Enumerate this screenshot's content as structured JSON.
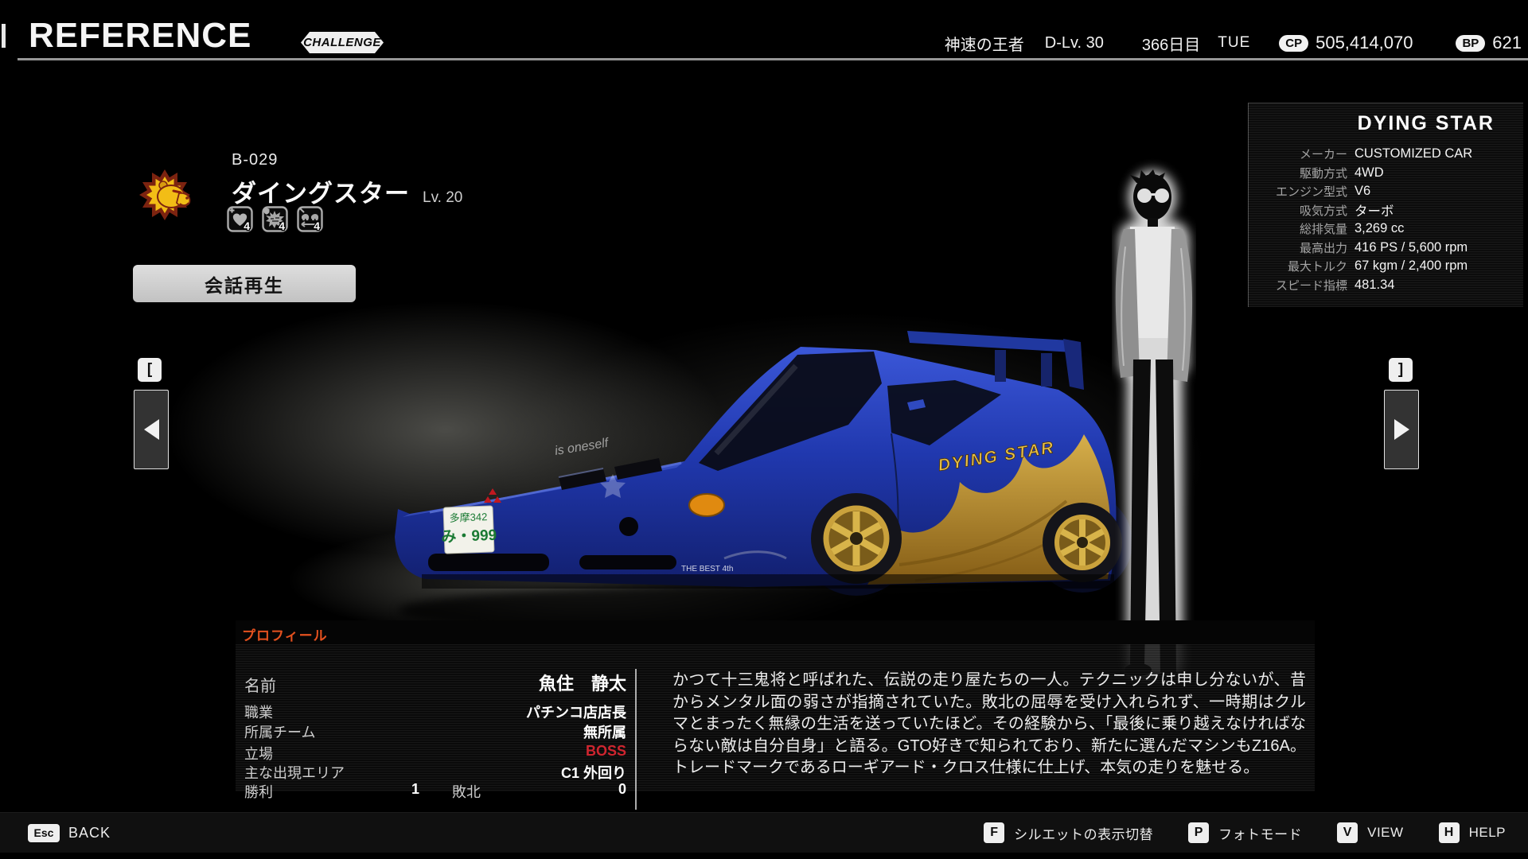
{
  "header": {
    "title": "REFERENCE",
    "badge": "CHALLENGE",
    "status": {
      "rank": "神速の王者",
      "driver_level": "D-Lv. 30",
      "day": "366日目",
      "weekday": "TUE",
      "cp_label": "CP",
      "cp_value": "505,414,070",
      "bp_label": "BP",
      "bp_value": "621"
    }
  },
  "rival": {
    "id": "B-029",
    "name": "ダイングスター",
    "level": "Lv. 20",
    "badges": [
      {
        "icon": "heart-gauge",
        "count": "4"
      },
      {
        "icon": "battle-burst",
        "count": "4"
      },
      {
        "icon": "race-cars",
        "count": "4"
      }
    ],
    "play_button": "会話再生"
  },
  "carousel": {
    "prev_key": "[",
    "next_key": "]"
  },
  "car_panel": {
    "title": "DYING STAR",
    "specs": [
      {
        "label": "メーカー",
        "value": "CUSTOMIZED CAR"
      },
      {
        "label": "駆動方式",
        "value": "4WD"
      },
      {
        "label": "エンジン型式",
        "value": "V6"
      },
      {
        "label": "吸気方式",
        "value": "ターボ"
      },
      {
        "label": "総排気量",
        "value": "3,269 cc"
      },
      {
        "label": "最高出力",
        "value": "416 PS / 5,600 rpm"
      },
      {
        "label": "最大トルク",
        "value": "67 kgm / 2,400 rpm"
      },
      {
        "label": "スピード指標",
        "value": "481.34"
      }
    ]
  },
  "scene": {
    "license_plate": {
      "top": "多摩342",
      "bottom": "み・999"
    },
    "livery_text": "DYING STAR",
    "hood_text": "is oneself",
    "decal_text": "THE BEST 4th",
    "car_color": "#2038ae",
    "livery_color": "#c9982e"
  },
  "profile": {
    "title": "プロフィール",
    "rows": [
      {
        "label": "名前",
        "value": "魚住　静太"
      },
      {
        "label": "職業",
        "value": "パチンコ店店長"
      },
      {
        "label": "所属チーム",
        "value": "無所属"
      },
      {
        "label": "立場",
        "value": "BOSS"
      },
      {
        "label": "主な出現エリア",
        "value": "C1 外回り"
      }
    ],
    "record": {
      "win_label": "勝利",
      "win_value": "1",
      "lose_label": "敗北",
      "lose_value": "0"
    },
    "boss_color": "#d0252f",
    "description": "かつて十三鬼将と呼ばれた、伝説の走り屋たちの一人。テクニックは申し分ないが、昔からメンタル面の弱さが指摘されていた。敗北の屈辱を受け入れられず、一時期はクルマとまったく無縁の生活を送っていたほど。その経験から、「最後に乗り越えなければならない敵は自分自身」と語る。GTO好きで知られており、新たに選んだマシンもZ16A。トレードマークであるローギアード・クロス仕様に仕上げ、本気の走りを魅せる。"
  },
  "footer": {
    "back": {
      "key": "Esc",
      "label": "BACK"
    },
    "actions": [
      {
        "key": "F",
        "label": "シルエットの表示切替"
      },
      {
        "key": "P",
        "label": "フォトモード"
      },
      {
        "key": "V",
        "label": "VIEW"
      },
      {
        "key": "H",
        "label": "HELP"
      }
    ]
  }
}
